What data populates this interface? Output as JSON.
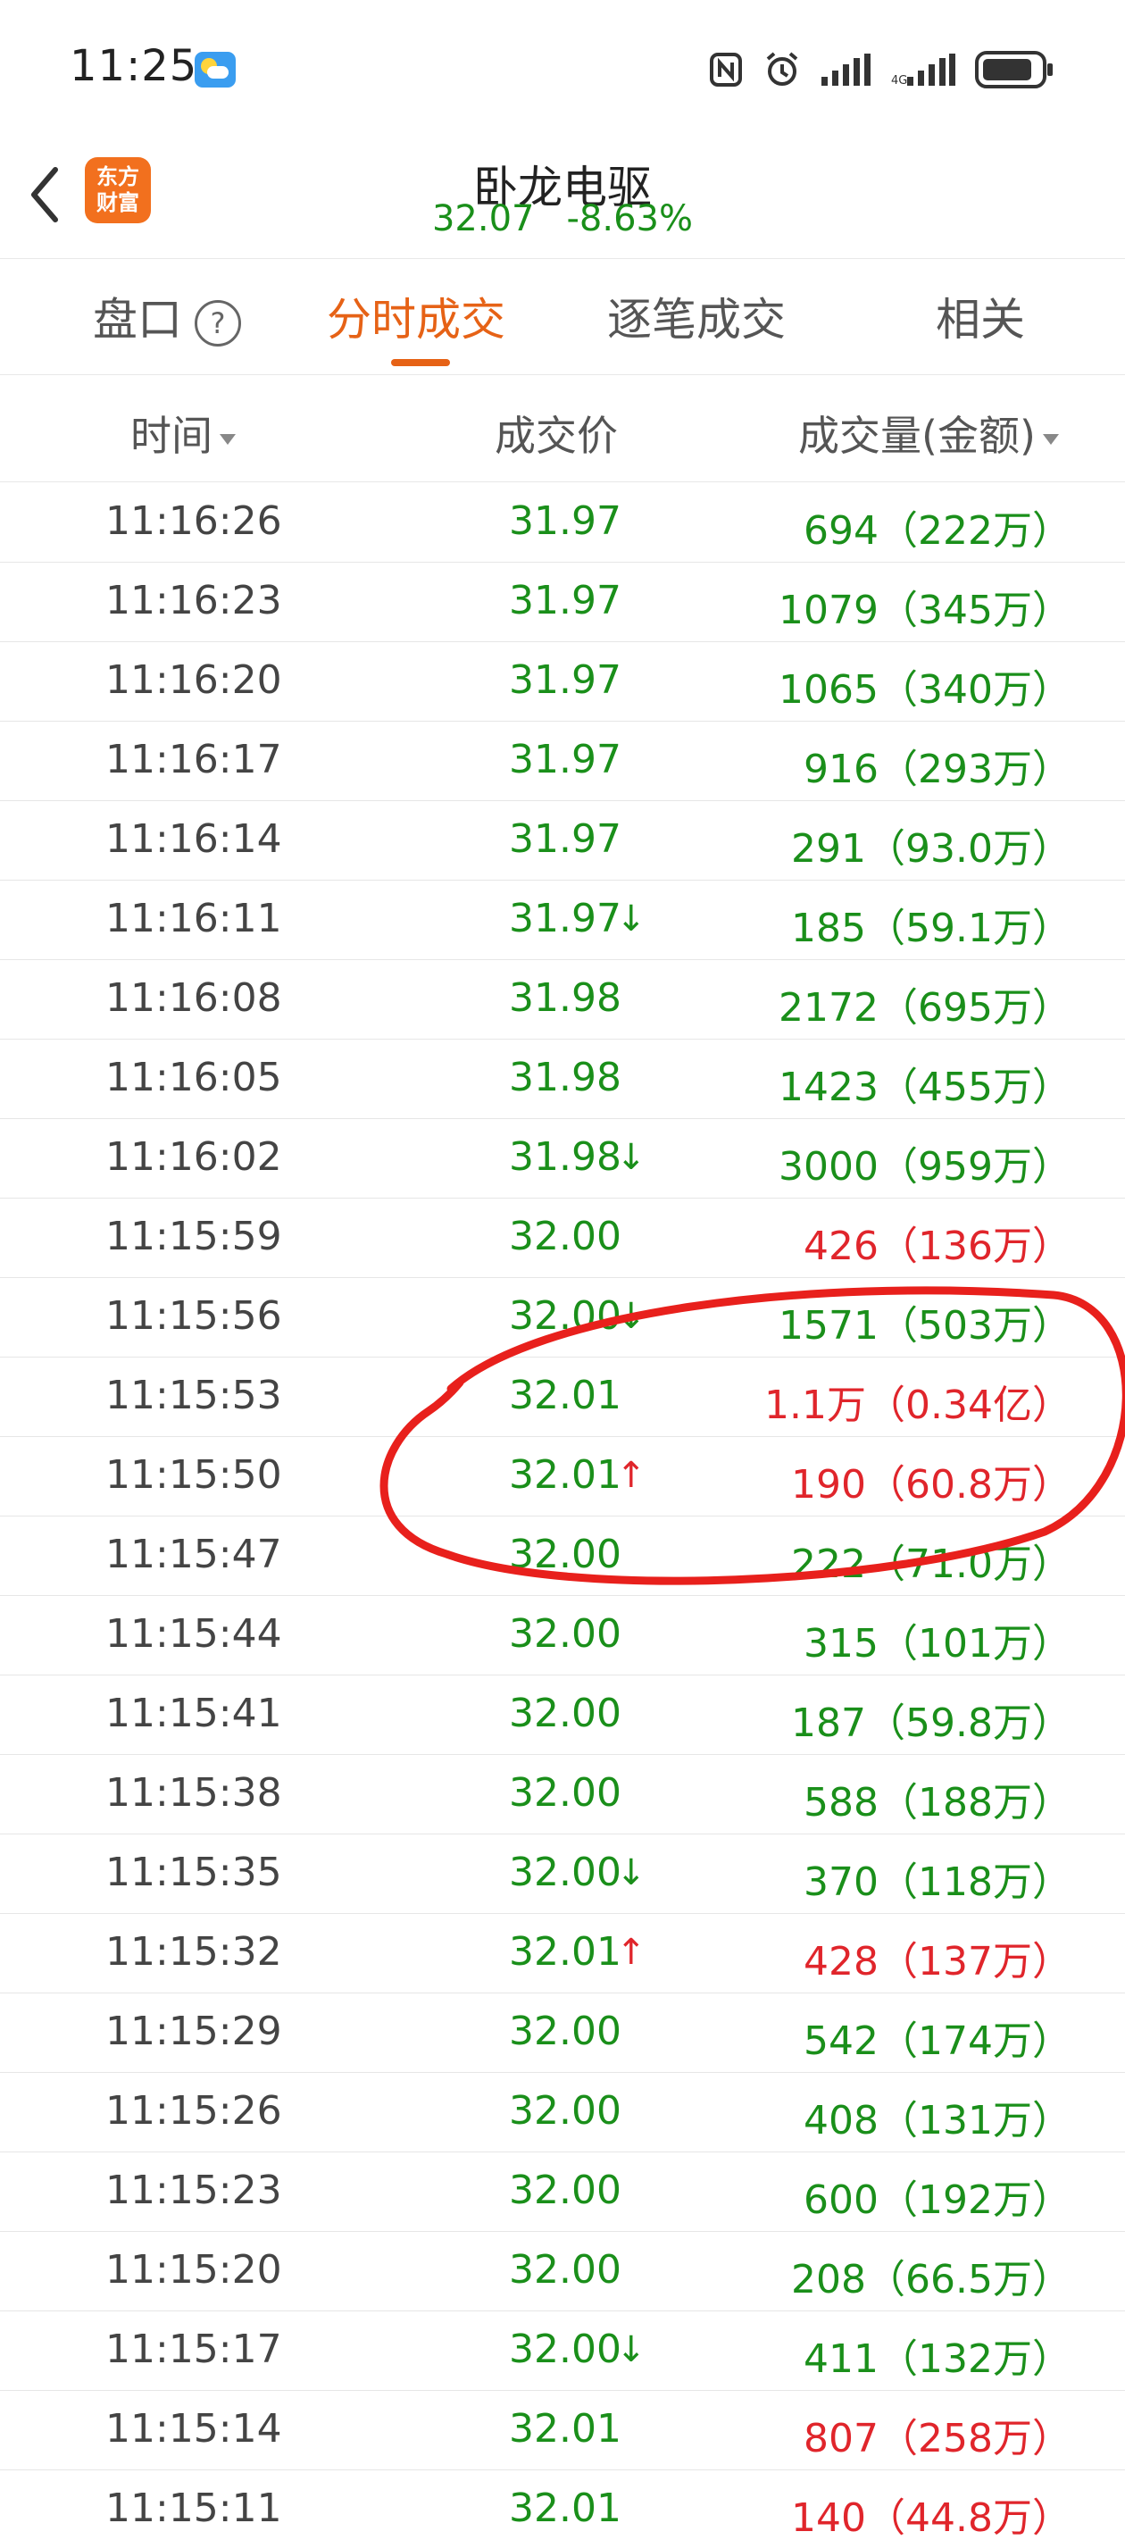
{
  "status_bar": {
    "time": "11:25"
  },
  "header": {
    "logo_text": "东方\n财富",
    "title": "卧龙电驱",
    "price": "32.07",
    "change": "-8.63%"
  },
  "tabs": [
    {
      "label": "盘口"
    },
    {
      "label": "分时成交"
    },
    {
      "label": "逐笔成交"
    },
    {
      "label": "相关"
    }
  ],
  "columns": {
    "time": "时间",
    "price": "成交价",
    "volume": "成交量(金额)"
  },
  "colors": {
    "up": "#e0252b",
    "down": "#1a8f1a",
    "accent": "#e66216"
  },
  "trades": [
    {
      "time": "11:16:26",
      "price": "31.97",
      "arrow": "",
      "volume": "694（222万）",
      "price_color": "green",
      "vol_color": "green"
    },
    {
      "time": "11:16:23",
      "price": "31.97",
      "arrow": "",
      "volume": "1079（345万）",
      "price_color": "green",
      "vol_color": "green"
    },
    {
      "time": "11:16:20",
      "price": "31.97",
      "arrow": "",
      "volume": "1065（340万）",
      "price_color": "green",
      "vol_color": "green"
    },
    {
      "time": "11:16:17",
      "price": "31.97",
      "arrow": "",
      "volume": "916（293万）",
      "price_color": "green",
      "vol_color": "green"
    },
    {
      "time": "11:16:14",
      "price": "31.97",
      "arrow": "",
      "volume": "291（93.0万）",
      "price_color": "green",
      "vol_color": "green"
    },
    {
      "time": "11:16:11",
      "price": "31.97",
      "arrow": "↓",
      "volume": "185（59.1万）",
      "price_color": "green",
      "vol_color": "green"
    },
    {
      "time": "11:16:08",
      "price": "31.98",
      "arrow": "",
      "volume": "2172（695万）",
      "price_color": "green",
      "vol_color": "green"
    },
    {
      "time": "11:16:05",
      "price": "31.98",
      "arrow": "",
      "volume": "1423（455万）",
      "price_color": "green",
      "vol_color": "green"
    },
    {
      "time": "11:16:02",
      "price": "31.98",
      "arrow": "↓",
      "volume": "3000（959万）",
      "price_color": "green",
      "vol_color": "green"
    },
    {
      "time": "11:15:59",
      "price": "32.00",
      "arrow": "",
      "volume": "426（136万）",
      "price_color": "green",
      "vol_color": "red"
    },
    {
      "time": "11:15:56",
      "price": "32.00",
      "arrow": "↓",
      "volume": "1571（503万）",
      "price_color": "green",
      "vol_color": "green"
    },
    {
      "time": "11:15:53",
      "price": "32.01",
      "arrow": "",
      "volume": "1.1万（0.34亿）",
      "price_color": "green",
      "vol_color": "red"
    },
    {
      "time": "11:15:50",
      "price": "32.01",
      "arrow": "↑",
      "volume": "190（60.8万）",
      "price_color": "green",
      "vol_color": "red"
    },
    {
      "time": "11:15:47",
      "price": "32.00",
      "arrow": "",
      "volume": "222（71.0万）",
      "price_color": "green",
      "vol_color": "green"
    },
    {
      "time": "11:15:44",
      "price": "32.00",
      "arrow": "",
      "volume": "315（101万）",
      "price_color": "green",
      "vol_color": "green"
    },
    {
      "time": "11:15:41",
      "price": "32.00",
      "arrow": "",
      "volume": "187（59.8万）",
      "price_color": "green",
      "vol_color": "green"
    },
    {
      "time": "11:15:38",
      "price": "32.00",
      "arrow": "",
      "volume": "588（188万）",
      "price_color": "green",
      "vol_color": "green"
    },
    {
      "time": "11:15:35",
      "price": "32.00",
      "arrow": "↓",
      "volume": "370（118万）",
      "price_color": "green",
      "vol_color": "green"
    },
    {
      "time": "11:15:32",
      "price": "32.01",
      "arrow": "↑",
      "volume": "428（137万）",
      "price_color": "green",
      "vol_color": "red"
    },
    {
      "time": "11:15:29",
      "price": "32.00",
      "arrow": "",
      "volume": "542（174万）",
      "price_color": "green",
      "vol_color": "green"
    },
    {
      "time": "11:15:26",
      "price": "32.00",
      "arrow": "",
      "volume": "408（131万）",
      "price_color": "green",
      "vol_color": "green"
    },
    {
      "time": "11:15:23",
      "price": "32.00",
      "arrow": "",
      "volume": "600（192万）",
      "price_color": "green",
      "vol_color": "green"
    },
    {
      "time": "11:15:20",
      "price": "32.00",
      "arrow": "",
      "volume": "208（66.5万）",
      "price_color": "green",
      "vol_color": "green"
    },
    {
      "time": "11:15:17",
      "price": "32.00",
      "arrow": "↓",
      "volume": "411（132万）",
      "price_color": "green",
      "vol_color": "green"
    },
    {
      "time": "11:15:14",
      "price": "32.01",
      "arrow": "",
      "volume": "807（258万）",
      "price_color": "green",
      "vol_color": "red"
    },
    {
      "time": "11:15:11",
      "price": "32.01",
      "arrow": "",
      "volume": "140（44.8万）",
      "price_color": "green",
      "vol_color": "red"
    }
  ]
}
